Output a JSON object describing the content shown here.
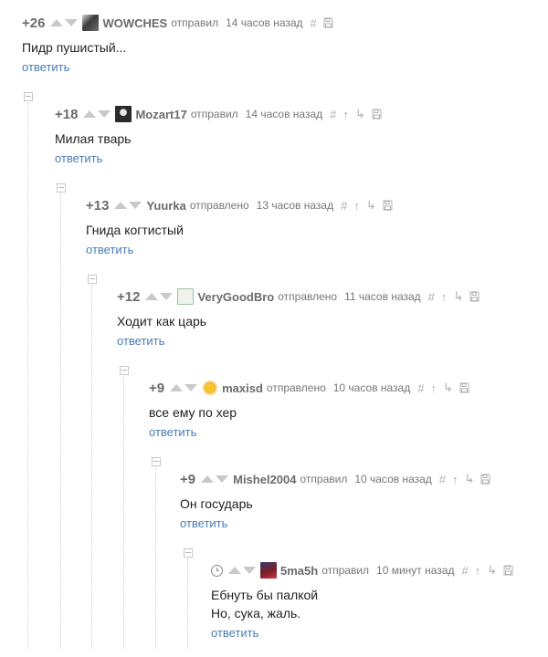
{
  "comments": [
    {
      "rating": "+26",
      "author": "WOWCHES",
      "action": "отправил",
      "time": "14 часов назад",
      "lines": [
        "Пидр пушистый..."
      ],
      "reply": "ответить",
      "icons": [
        "hash-icon",
        "save-icon"
      ],
      "avatar_color": "#3a3a3a"
    },
    {
      "rating": "+18",
      "author": "Mozart17",
      "action": "отправил",
      "time": "14 часов назад",
      "lines": [
        "Милая тварь"
      ],
      "reply": "ответить",
      "icons": [
        "hash-icon",
        "parent-arrow-icon",
        "branch-icon",
        "save-icon"
      ],
      "avatar_color": "#2b2b2b"
    },
    {
      "rating": "+13",
      "author": "Yuurka",
      "action": "отправлено",
      "time": "13 часов назад",
      "lines": [
        "Гнида когтистый"
      ],
      "reply": "ответить",
      "icons": [
        "hash-icon",
        "parent-arrow-icon",
        "branch-icon",
        "save-icon"
      ],
      "avatar_color": ""
    },
    {
      "rating": "+12",
      "author": "VeryGoodBro",
      "action": "отправлено",
      "time": "11 часов назад",
      "lines": [
        "Ходит как царь"
      ],
      "reply": "ответить",
      "icons": [
        "hash-icon",
        "parent-arrow-icon",
        "branch-icon",
        "save-icon"
      ],
      "avatar_color": "#9fc2a0"
    },
    {
      "rating": "+9",
      "author": "maxisd",
      "action": "отправлено",
      "time": "10 часов назад",
      "lines": [
        "все ему по хер"
      ],
      "reply": "ответить",
      "icons": [
        "hash-icon",
        "parent-arrow-icon",
        "branch-icon",
        "save-icon"
      ],
      "avatar_color": "#f2b21c"
    },
    {
      "rating": "+9",
      "author": "Mishel2004",
      "action": "отправил",
      "time": "10 часов назад",
      "lines": [
        "Он государь"
      ],
      "reply": "ответить",
      "icons": [
        "hash-icon",
        "parent-arrow-icon",
        "branch-icon",
        "save-icon"
      ],
      "avatar_color": ""
    },
    {
      "rating": "",
      "author": "5ma5h",
      "action": "отправил",
      "time": "10 минут назад",
      "lines": [
        "Ебнуть бы палкой",
        "Но, сука, жаль."
      ],
      "reply": "ответить",
      "icons": [
        "hash-icon",
        "parent-arrow-icon",
        "branch-icon",
        "save-icon"
      ],
      "avatar_color": "#7a1e2a"
    }
  ]
}
